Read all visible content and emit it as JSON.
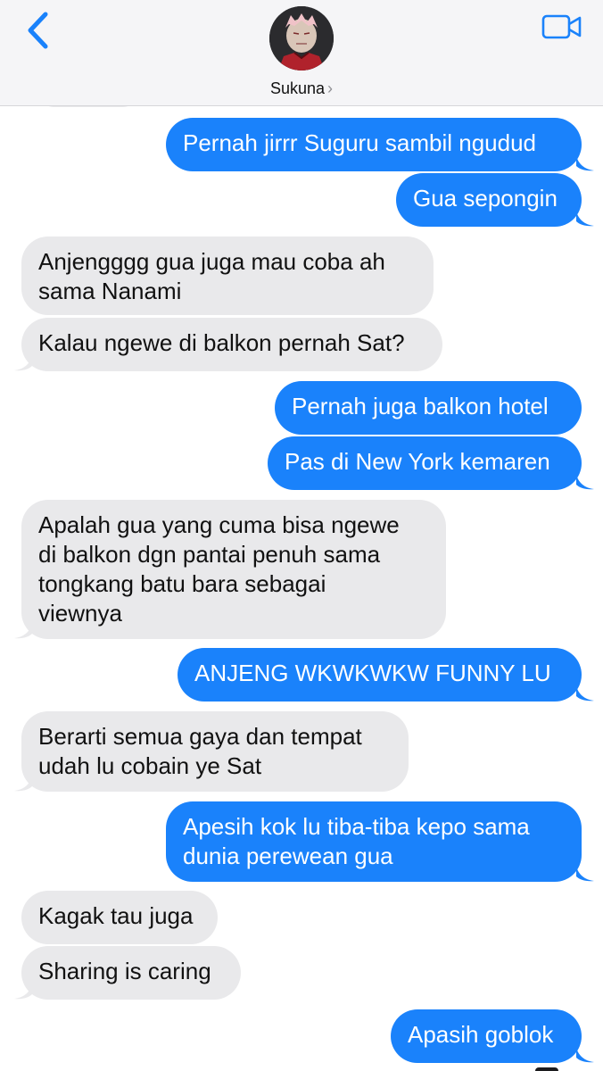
{
  "header": {
    "contact_name": "Sukuna",
    "chevron": "›",
    "back_icon": "chevron-left-icon",
    "video_icon": "video-camera-icon",
    "accent_color": "#1a82fb"
  },
  "colors": {
    "outgoing_bubble": "#1a82fb",
    "incoming_bubble": "#e9e9eb",
    "header_bg": "#f5f5f7"
  },
  "messages": [
    {
      "dir": "out",
      "text": "Pernah jirrr Suguru sambil ngudud"
    },
    {
      "dir": "out",
      "text": "Gua sepongin"
    },
    {
      "dir": "in",
      "text": "Anjengggg gua juga mau coba ah\nsama Nanami"
    },
    {
      "dir": "in",
      "text": "Kalau ngewe di balkon pernah Sat?"
    },
    {
      "dir": "out",
      "text": "Pernah juga balkon hotel"
    },
    {
      "dir": "out",
      "text": "Pas di New York kemaren"
    },
    {
      "dir": "in",
      "text": "Apalah gua yang cuma bisa ngewe\ndi balkon dgn pantai penuh sama\ntongkang batu bara sebagai\nviewnya"
    },
    {
      "dir": "out",
      "text": "ANJENG WKWKWKW FUNNY LU"
    },
    {
      "dir": "in",
      "text": "Berarti semua gaya dan tempat\nudah lu cobain ye Sat"
    },
    {
      "dir": "out",
      "text": "Apesih kok lu tiba-tiba kepo sama\ndunia perewean gua"
    },
    {
      "dir": "in",
      "text": "Kagak tau juga"
    },
    {
      "dir": "in",
      "text": "Sharing is caring"
    },
    {
      "dir": "out",
      "text": "Apasih goblok"
    }
  ]
}
